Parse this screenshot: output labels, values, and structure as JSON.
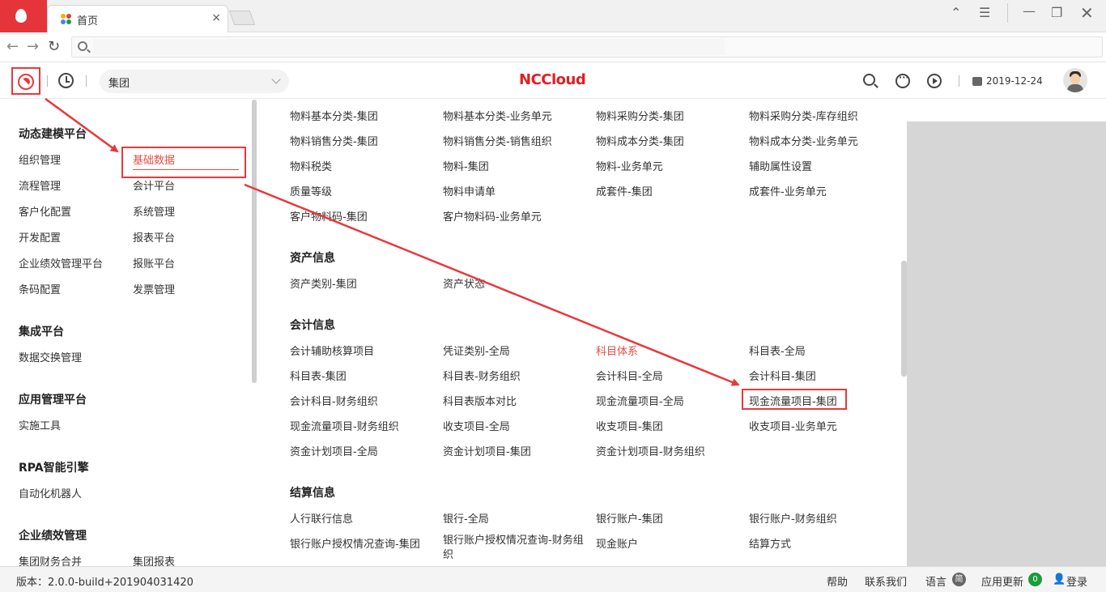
{
  "browser": {
    "tab_title": "首页",
    "tab_close": "×"
  },
  "header": {
    "org_select_value": "集团",
    "logo_text": "NCCloud",
    "date": "2019-12-24"
  },
  "left_menu": {
    "groups": [
      {
        "title": "动态建模平台",
        "items": [
          "组织管理",
          "基础数据",
          "流程管理",
          "会计平台",
          "客户化配置",
          "系统管理",
          "开发配置",
          "报表平台",
          "企业绩效管理平台",
          "报账平台",
          "条码配置",
          "发票管理"
        ]
      },
      {
        "title": "集成平台",
        "items": [
          "数据交换管理"
        ]
      },
      {
        "title": "应用管理平台",
        "items": [
          "实施工具"
        ]
      },
      {
        "title": "RPA智能引擎",
        "items": [
          "自动化机器人"
        ]
      },
      {
        "title": "企业绩效管理",
        "items": [
          "集团财务合并",
          "集团报表"
        ]
      }
    ],
    "active_item": "基础数据"
  },
  "content": {
    "material_rows": [
      [
        "物料基本分类-集团",
        "物料基本分类-业务单元",
        "物料采购分类-集团",
        "物料采购分类-库存组织"
      ],
      [
        "物料销售分类-集团",
        "物料销售分类-销售组织",
        "物料成本分类-集团",
        "物料成本分类-业务单元"
      ],
      [
        "物料税类",
        "物料-集团",
        "物料-业务单元",
        "辅助属性设置"
      ],
      [
        "质量等级",
        "物料申请单",
        "成套件-集团",
        "成套件-业务单元"
      ],
      [
        "客户物料码-集团",
        "客户物料码-业务单元"
      ]
    ],
    "asset_title": "资产信息",
    "asset_rows": [
      [
        "资产类别-集团",
        "资产状态"
      ]
    ],
    "accounting_title": "会计信息",
    "accounting_rows": [
      [
        "会计辅助核算项目",
        "凭证类别-全局",
        "科目体系",
        "科目表-全局"
      ],
      [
        "科目表-集团",
        "科目表-财务组织",
        "会计科目-全局",
        "会计科目-集团"
      ],
      [
        "会计科目-财务组织",
        "科目表版本对比",
        "现金流量项目-全局",
        "现金流量项目-集团"
      ],
      [
        "现金流量项目-财务组织",
        "收支项目-全局",
        "收支项目-集团",
        "收支项目-业务单元"
      ],
      [
        "资金计划项目-全局",
        "资金计划项目-集团",
        "资金计划项目-财务组织"
      ]
    ],
    "settlement_title": "结算信息",
    "settlement_rows": [
      [
        "人行联行信息",
        "银行-全局",
        "银行账户-集团",
        "银行账户-财务组织"
      ],
      [
        "银行账户授权情况查询-集团",
        "银行账户授权情况查询-财务组\n织",
        "现金账户",
        "结算方式"
      ]
    ],
    "highlighted_item": "现金流量项目-集团",
    "red_item": "科目体系"
  },
  "footer": {
    "version": "版本：2.0.0-build+201904031420",
    "help": "帮助",
    "contact": "联系我们",
    "language": "语言",
    "language_badge": "简",
    "update": "应用更新",
    "update_count": "0",
    "login": "登录"
  },
  "colors": {
    "accent_red": "#e8383d",
    "logo_red": "#e01e24",
    "update_green": "#1a9c3b"
  }
}
